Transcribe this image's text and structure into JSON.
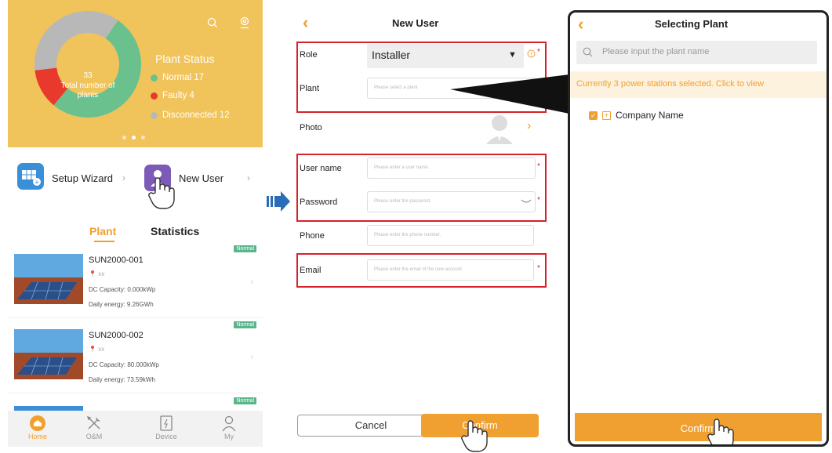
{
  "home": {
    "plant_status_title": "Plant Status",
    "total_count": "33",
    "total_label": "Total number of plants",
    "legend": [
      {
        "label": "Normal 17",
        "color": "#6ac18e"
      },
      {
        "label": "Faulty 4",
        "color": "#e8392c"
      },
      {
        "label": "Disconnected 12",
        "color": "#b8b8b8"
      }
    ],
    "shortcuts": {
      "setup_wizard": "Setup Wizard",
      "new_user": "New User"
    },
    "tabs": {
      "plant": "Plant",
      "statistics": "Statistics"
    },
    "plants": [
      {
        "name": "SUN2000-001",
        "location": "xx",
        "dc_capacity": "DC Capacity: 0.000kWp",
        "daily_energy": "Daily energy: 9.26GWh",
        "status": "Normal"
      },
      {
        "name": "SUN2000-002",
        "location": "xx",
        "dc_capacity": "DC Capacity: 80.000kWp",
        "daily_energy": "Daily energy: 73.59kWh",
        "status": "Normal"
      },
      {
        "status": "Normal"
      }
    ],
    "nav": {
      "home": "Home",
      "om": "O&M",
      "device": "Device",
      "my": "My"
    },
    "accent": "#f0a030",
    "hero_color": "#f1c35b"
  },
  "new_user": {
    "title": "New User",
    "role_label": "Role",
    "role_value": "Installer",
    "plant_label": "Plant",
    "plant_placeholder": "Please select a plant",
    "photo_label": "Photo",
    "username_label": "User name",
    "username_placeholder": "Please enter a user name.",
    "password_label": "Password",
    "password_placeholder": "Please enter the password.",
    "phone_label": "Phone",
    "phone_placeholder": "Please enter the phone number.",
    "email_label": "Email",
    "email_placeholder": "Please enter the email of the new account.",
    "required_mark": "*",
    "cancel": "Cancel",
    "confirm": "Confirm"
  },
  "selecting_plant": {
    "title": "Selecting Plant",
    "search_placeholder": "Please input the plant name",
    "selection_info": "Currently 3 power stations selected. Click to view",
    "company": "Company Name",
    "confirm": "Confirm"
  },
  "highlight_color": "#d6222a"
}
